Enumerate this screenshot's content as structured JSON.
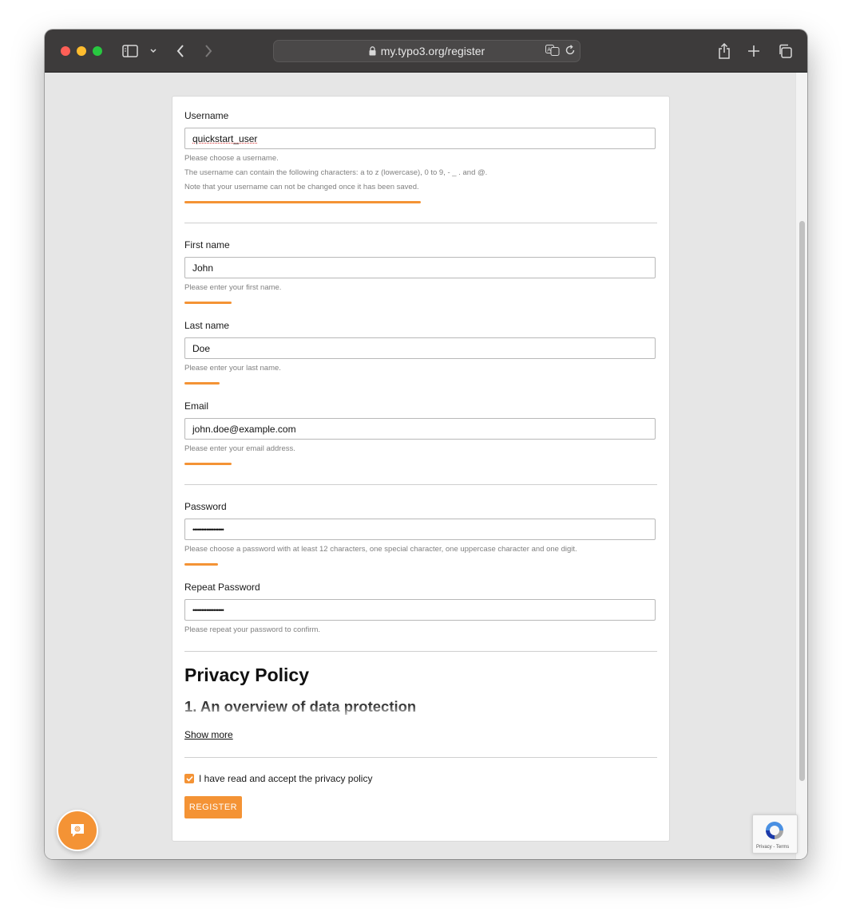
{
  "browser": {
    "url": "my.typo3.org/register"
  },
  "form": {
    "username": {
      "label": "Username",
      "value": "quickstart_user",
      "help": [
        "Please choose a username.",
        "The username can contain the following characters: a to z (lowercase), 0 to 9, - _ . and @.",
        "Note that your username can not be changed once it has been saved."
      ]
    },
    "first_name": {
      "label": "First name",
      "value": "John",
      "help": "Please enter your first name."
    },
    "last_name": {
      "label": "Last name",
      "value": "Doe",
      "help": "Please enter your last name."
    },
    "email": {
      "label": "Email",
      "value": "john.doe@example.com",
      "help": "Please enter your email address."
    },
    "password": {
      "label": "Password",
      "value": "••••••••••••••••••",
      "help": "Please choose a password with at least 12 characters, one special character, one uppercase character and one digit."
    },
    "repeat_password": {
      "label": "Repeat Password",
      "value": "••••••••••••••••••",
      "help": "Please repeat your password to confirm."
    },
    "privacy": {
      "heading": "Privacy Policy",
      "subheading": "1. An overview of data protection",
      "show_more": "Show more",
      "accept_label": "I have read and accept the privacy policy",
      "accepted": true
    },
    "submit_label": "REGISTER"
  },
  "recaptcha": {
    "footer": "Privacy - Terms"
  },
  "colors": {
    "accent": "#f49335",
    "titlebar": "#3d3b3b",
    "page_bg": "#e6e6e6"
  }
}
